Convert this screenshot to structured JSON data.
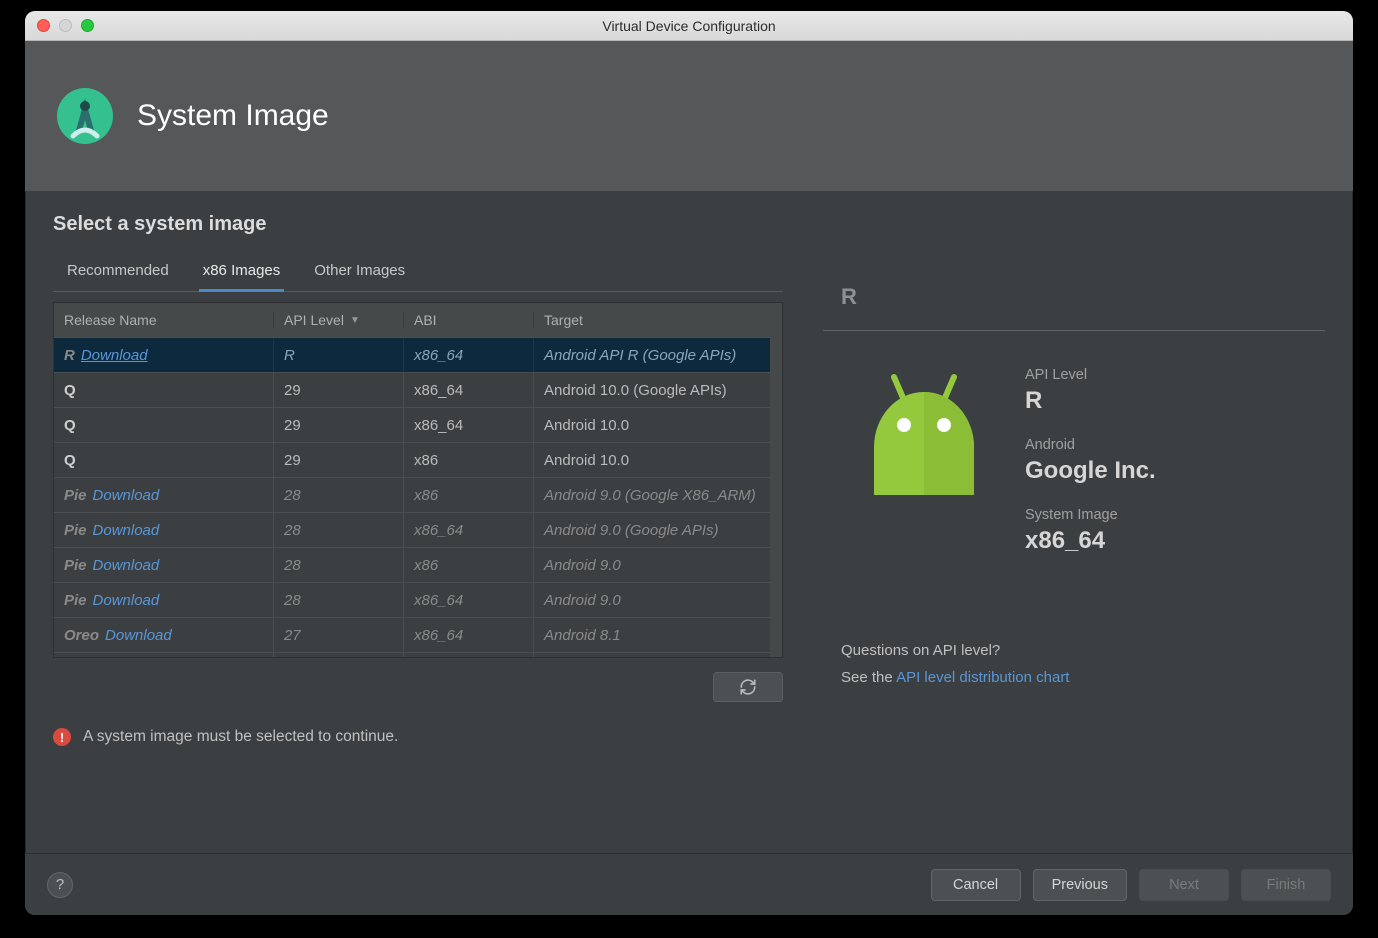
{
  "window": {
    "title": "Virtual Device Configuration"
  },
  "header": {
    "title": "System Image"
  },
  "subtitle": "Select a system image",
  "tabs": [
    {
      "label": "Recommended",
      "active": false
    },
    {
      "label": "x86 Images",
      "active": true
    },
    {
      "label": "Other Images",
      "active": false
    }
  ],
  "columns": {
    "release": "Release Name",
    "api": "API Level",
    "abi": "ABI",
    "target": "Target"
  },
  "download_label": "Download",
  "rows": [
    {
      "release": "R",
      "download": true,
      "underline": true,
      "api": "R",
      "abi": "x86_64",
      "target": "Android API R (Google APIs)",
      "italic": true,
      "selected": true
    },
    {
      "release": "Q",
      "download": false,
      "api": "29",
      "abi": "x86_64",
      "target": "Android 10.0 (Google APIs)",
      "italic": false
    },
    {
      "release": "Q",
      "download": false,
      "api": "29",
      "abi": "x86_64",
      "target": "Android 10.0",
      "italic": false
    },
    {
      "release": "Q",
      "download": false,
      "api": "29",
      "abi": "x86",
      "target": "Android 10.0",
      "italic": false
    },
    {
      "release": "Pie",
      "download": true,
      "api": "28",
      "abi": "x86",
      "target": "Android 9.0 (Google X86_ARM)",
      "italic": true
    },
    {
      "release": "Pie",
      "download": true,
      "api": "28",
      "abi": "x86_64",
      "target": "Android 9.0 (Google APIs)",
      "italic": true
    },
    {
      "release": "Pie",
      "download": true,
      "api": "28",
      "abi": "x86",
      "target": "Android 9.0",
      "italic": true
    },
    {
      "release": "Pie",
      "download": true,
      "api": "28",
      "abi": "x86_64",
      "target": "Android 9.0",
      "italic": true
    },
    {
      "release": "Oreo",
      "download": true,
      "api": "27",
      "abi": "x86_64",
      "target": "Android 8.1",
      "italic": true
    }
  ],
  "right": {
    "heading": "R",
    "api_label": "API Level",
    "api_value": "R",
    "android_label": "Android",
    "android_value": "Google Inc.",
    "sysimg_label": "System Image",
    "sysimg_value": "x86_64",
    "question": "Questions on API level?",
    "see_prefix": "See the ",
    "chart_link": "API level distribution chart"
  },
  "warning": "A system image must be selected to continue.",
  "footer": {
    "help": "?",
    "cancel": "Cancel",
    "previous": "Previous",
    "next": "Next",
    "finish": "Finish"
  }
}
